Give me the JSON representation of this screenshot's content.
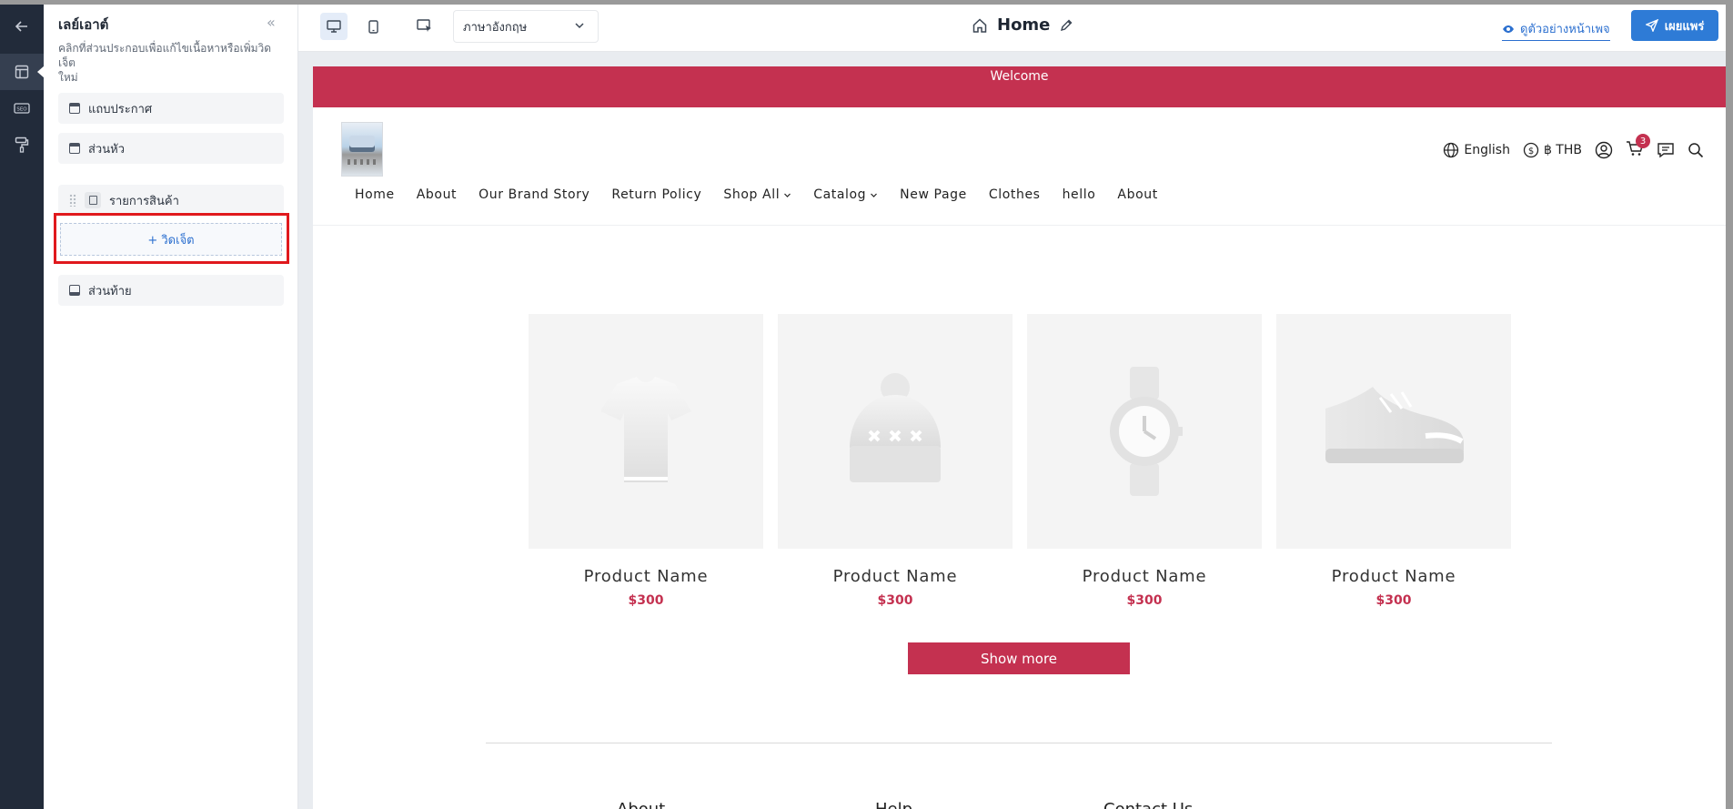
{
  "panel": {
    "title": "เลย์เอาต์",
    "description": "คลิกที่ส่วนประกอบเพื่อแก้ไขเนื้อหาหรือเพิ่มวิดเจ็ต\nใหม่",
    "sections": {
      "announcement": "แถบประกาศ",
      "header": "ส่วนหัว",
      "product_list": "รายการสินค้า",
      "add_widget": "+ วิดเจ็ต",
      "footer": "ส่วนท้าย"
    }
  },
  "toolbar": {
    "language": "ภาษาอังกฤษ",
    "page_name": "Home",
    "preview": "ดูตัวอย่างหน้าเพจ",
    "publish": "เผยแพร่"
  },
  "site": {
    "banner": "Welcome",
    "language": "English",
    "currency": "฿ THB",
    "cart_count": "3",
    "nav": [
      "Home",
      "About",
      "Our Brand Story",
      "Return Policy",
      "Shop All",
      "Catalog",
      "New Page",
      "Clothes",
      "hello",
      "About"
    ],
    "products": [
      {
        "name": "Product Name",
        "price": "$300",
        "icon": "tshirt-icon"
      },
      {
        "name": "Product Name",
        "price": "$300",
        "icon": "beanie-icon"
      },
      {
        "name": "Product Name",
        "price": "$300",
        "icon": "watch-icon"
      },
      {
        "name": "Product Name",
        "price": "$300",
        "icon": "sneaker-icon"
      }
    ],
    "show_more": "Show more",
    "footer_columns": [
      "About",
      "Help",
      "Contact Us"
    ]
  },
  "colors": {
    "brand": "#c43150",
    "accent": "#2e7bd6",
    "rail": "#222b3a"
  }
}
